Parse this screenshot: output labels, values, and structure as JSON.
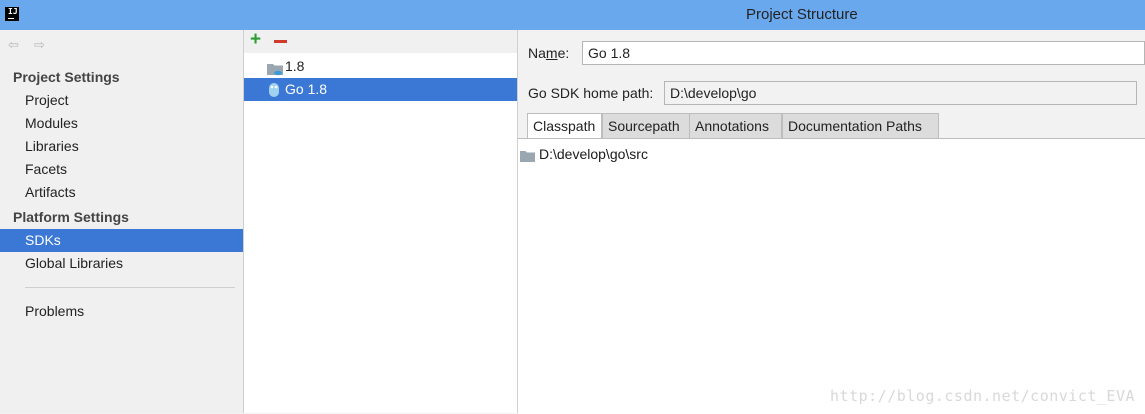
{
  "window": {
    "title": "Project Structure",
    "app_icon_text": "IJ"
  },
  "nav": {
    "back_icon": "back-arrow-icon",
    "forward_icon": "forward-arrow-icon",
    "project_settings_header": "Project Settings",
    "project_items": [
      "Project",
      "Modules",
      "Libraries",
      "Facets",
      "Artifacts"
    ],
    "platform_settings_header": "Platform Settings",
    "platform_items": [
      "SDKs",
      "Global Libraries"
    ],
    "selected": "SDKs",
    "problems": "Problems"
  },
  "sdk_list": {
    "add_icon": "plus-icon",
    "remove_icon": "minus-icon",
    "items": [
      {
        "label": "1.8",
        "icon": "jdk-folder-icon"
      },
      {
        "label": "Go 1.8",
        "icon": "go-sdk-icon"
      }
    ],
    "selected": "Go 1.8"
  },
  "details": {
    "name_label": "Name:",
    "name_value": "Go 1.8",
    "home_path_label": "Go SDK home path:",
    "home_path_value": "D:\\develop\\go",
    "tabs": [
      "Classpath",
      "Sourcepath",
      "Annotations",
      "Documentation Paths"
    ],
    "active_tab": "Classpath",
    "classpath_entries": [
      "D:\\develop\\go\\src"
    ]
  },
  "watermark": "http://blog.csdn.net/convict_EVA",
  "colors": {
    "titlebar": "#6aa8ee",
    "selection": "#3b78d6",
    "add": "#2a9e35",
    "remove": "#d13a2b"
  }
}
